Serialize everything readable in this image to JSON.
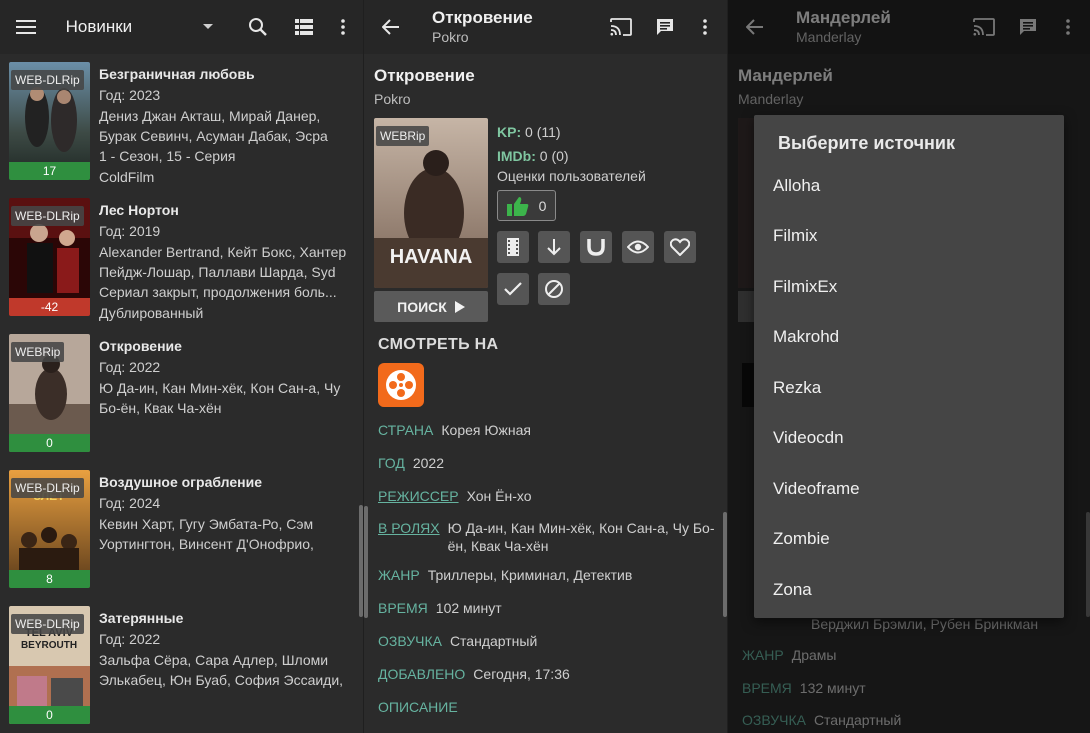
{
  "screen1": {
    "title": "Новинки",
    "items": [
      {
        "quality": "WEB-DLRip",
        "title": "Безграничная любовь",
        "year": "Год: 2023",
        "cast": "Дениз Джан Акташ, Мирай Данер, Бурак Севинч, Асуман Дабак, Эсра",
        "status": "1 - Сезон, 15 - Серия",
        "voice": "ColdFilm",
        "score": "17",
        "score_color": "#2f8f3f"
      },
      {
        "quality": "WEB-DLRip",
        "title": "Лес Нортон",
        "year": "Год: 2019",
        "cast": "Alexander Bertrand, Кейт Бокс, Хантер Пейдж-Лошар, Паллави Шарда, Syd",
        "status": "Сериал закрыт, продолжения боль...",
        "voice": "Дублированный",
        "score": "-42",
        "score_color": "#c0392b"
      },
      {
        "quality": "WEBRip",
        "title": "Откровение",
        "year": "Год: 2022",
        "cast": "Ю Да-ин, Кан Мин-хёк, Кон Сан-а, Чу Бо-ён, Квак Ча-хён",
        "status": "",
        "voice": "",
        "score": "0",
        "score_color": "#2f8f3f"
      },
      {
        "quality": "WEB-DLRip",
        "title": "Воздушное ограбление",
        "year": "Год: 2024",
        "cast": "Кевин Харт, Гугу Эмбата-Ро, Сэм Уортингтон, Винсент Д'Онофрио,",
        "status": "",
        "voice": "",
        "score": "8",
        "score_color": "#2f8f3f"
      },
      {
        "quality": "WEB-DLRip",
        "title": "Затерянные",
        "year": "Год: 2022",
        "cast": "Зальфа Сёра, Сара Адлер, Шломи Элькабец, Юн Буаб, София Эссаиди,",
        "status": "",
        "voice": "",
        "score": "0",
        "score_color": "#2f8f3f"
      }
    ]
  },
  "screen2": {
    "title": "Откровение",
    "subtitle": "Pokro",
    "heading": "Откровение",
    "heading_sub": "Pokro",
    "quality": "WEBRip",
    "poster_text": "HAVANA",
    "kp_label": "KP:",
    "kp_value": "0 (11)",
    "imdb_label": "IMDb:",
    "imdb_value": "0 (0)",
    "user_ratings": "Оценки пользователей",
    "likes": "0",
    "search_label": "ПОИСК",
    "watch_on": "СМОТРЕТЬ НА",
    "fields": [
      {
        "label": "СТРАНА",
        "value": "Корея Южная"
      },
      {
        "label": "ГОД",
        "value": "2022"
      },
      {
        "label": "РЕЖИССЕР",
        "value": "Хон Ён-хо"
      },
      {
        "label": "В РОЛЯХ",
        "value": "Ю Да-ин, Кан Мин-хёк, Кон Сан-а, Чу Бо-ён, Квак Ча-хён"
      },
      {
        "label": "ЖАНР",
        "value": "Триллеры, Криминал, Детектив"
      },
      {
        "label": "ВРЕМЯ",
        "value": "102 минут"
      },
      {
        "label": "ОЗВУЧКА",
        "value": "Стандартный"
      },
      {
        "label": "ДОБАВЛЕНО",
        "value": "Сегодня, 17:36"
      },
      {
        "label": "ОПИСАНИЕ",
        "value": ""
      }
    ]
  },
  "screen3": {
    "title": "Мандерлей",
    "subtitle": "Manderlay",
    "heading": "Мандерлей",
    "heading_sub": "Manderlay",
    "bg_cast_tail": "Верджил Брэмли, Рубен Бринкман",
    "bg_genre_label": "ЖАНР",
    "bg_genre": "Драмы",
    "bg_time_label": "ВРЕМЯ",
    "bg_time": "132 минут",
    "bg_voice_label": "ОЗВУЧКА",
    "bg_voice": "Стандартный",
    "dialog_title": "Выберите источник",
    "options": [
      "Alloha",
      "Filmix",
      "FilmixEx",
      "Makrohd",
      "Rezka",
      "Videocdn",
      "Videoframe",
      "Zombie",
      "Zona"
    ]
  },
  "icons": [
    "menu-icon",
    "dropdown-arrow-icon",
    "search-icon",
    "list-view-icon",
    "more-vert-icon",
    "back-arrow-icon",
    "cast-icon",
    "comment-icon"
  ]
}
